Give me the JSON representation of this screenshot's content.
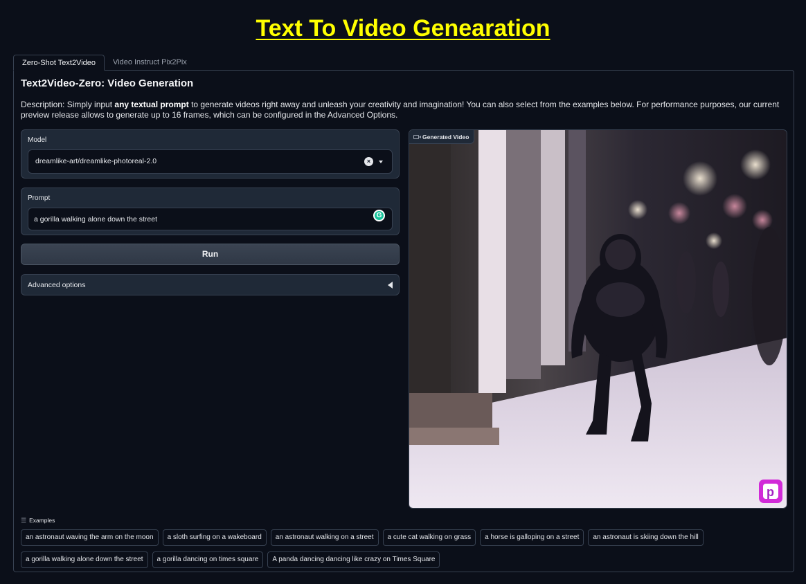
{
  "header": {
    "title": "Text To Video Genearation"
  },
  "tabs": [
    {
      "label": "Zero-Shot Text2Video",
      "active": true
    },
    {
      "label": "Video Instruct Pix2Pix",
      "active": false
    }
  ],
  "main": {
    "section_title": "Text2Video-Zero: Video Generation",
    "description": {
      "prefix": "Description: Simply input ",
      "bold": "any textual prompt",
      "suffix": " to generate videos right away and unleash your creativity and imagination! You can also select from the examples below. For performance purposes, our current preview release allows to generate up to 16 frames, which can be configured in the Advanced Options."
    },
    "model": {
      "label": "Model",
      "value": "dreamlike-art/dreamlike-photoreal-2.0"
    },
    "prompt": {
      "label": "Prompt",
      "value": "a gorilla walking alone down the street"
    },
    "run_label": "Run",
    "advanced_label": "Advanced options",
    "video": {
      "label": "Generated Video"
    }
  },
  "examples": {
    "label": "Examples",
    "items": [
      "an astronaut waving the arm on the moon",
      "a sloth surfing on a wakeboard",
      "an astronaut walking on a street",
      "a cute cat walking on grass",
      "a horse is galloping on a street",
      "an astronaut is skiing down the hill",
      "a gorilla walking alone down the street",
      "a gorilla dancing on times square",
      "A panda dancing dancing like crazy on Times Square"
    ]
  },
  "colors": {
    "title": "#ffff00",
    "background": "#0b0f19",
    "panel": "#1f2937",
    "border": "#374151"
  },
  "icons": [
    "clear-icon",
    "chevron-down-icon",
    "grammarly-icon",
    "triangle-left-icon",
    "video-camera-icon",
    "list-icon"
  ]
}
